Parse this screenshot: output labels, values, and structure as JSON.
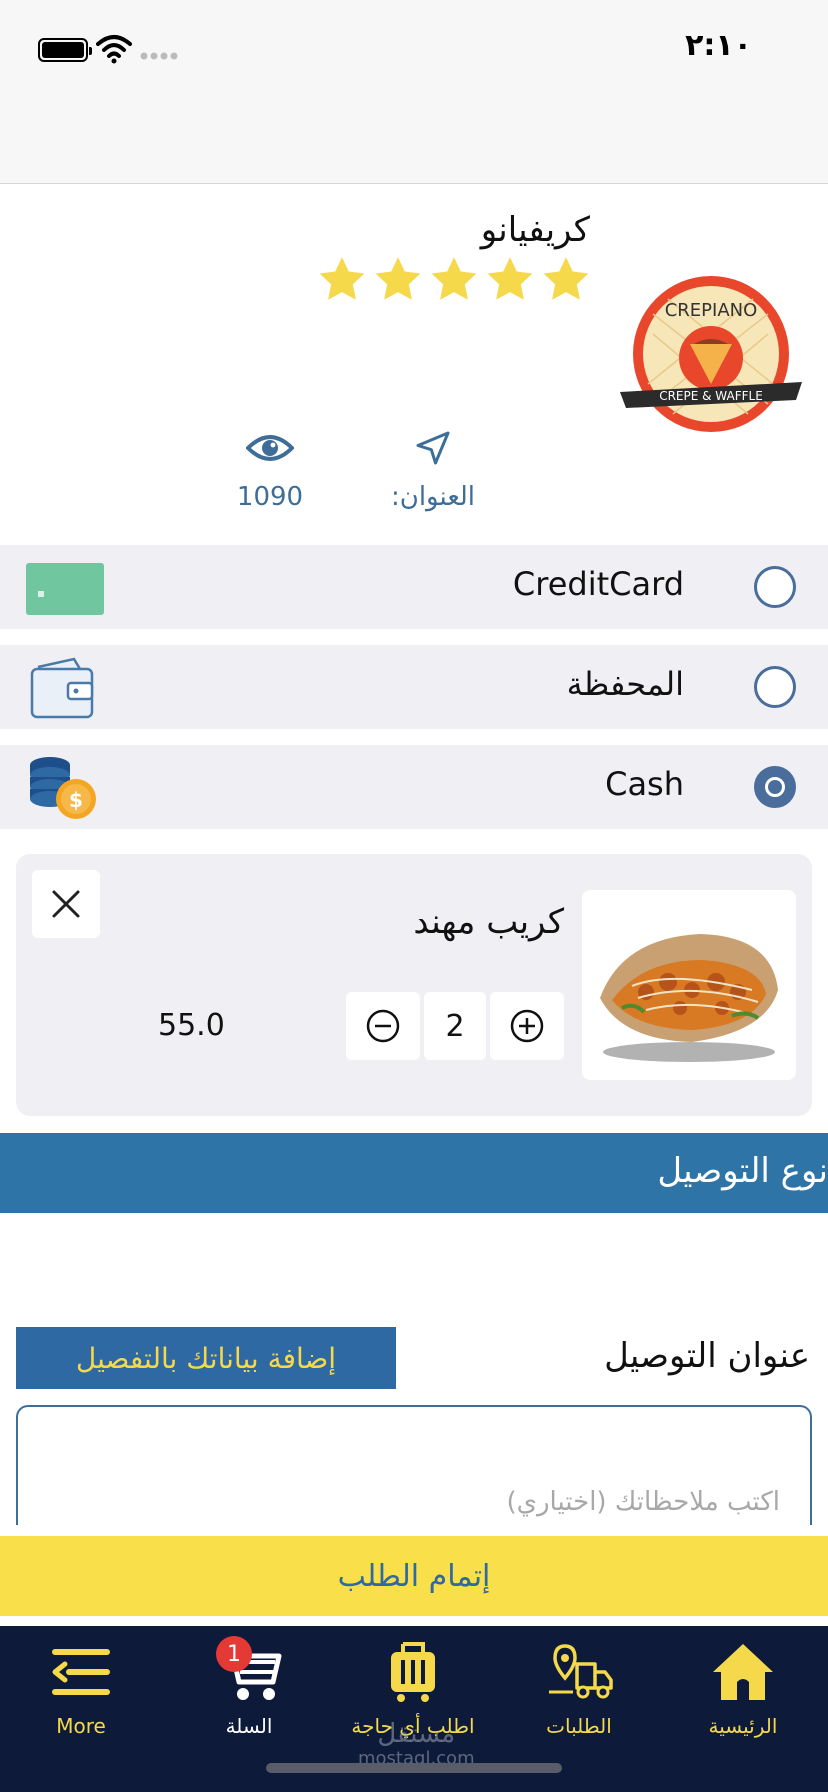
{
  "status": {
    "time": "٢:١٠"
  },
  "store": {
    "name": "كريفيانو",
    "rating": 5,
    "views": "1090",
    "address_label": "العنوان:",
    "logo": {
      "top": "CREPIANO",
      "banner": "CREPE & WAFFLE"
    }
  },
  "payment_methods": [
    {
      "label": "CreditCard",
      "icon": "credit-card-icon",
      "selected": false
    },
    {
      "label": "المحفظة",
      "icon": "wallet-icon",
      "selected": false
    },
    {
      "label": "Cash",
      "icon": "coins-icon",
      "selected": true
    }
  ],
  "cart_item": {
    "name": "كريب مهند",
    "quantity": "2",
    "price": "55.0"
  },
  "delivery": {
    "header": "نوع التوصيل",
    "address_title": "عنوان التوصيل",
    "details_button": "إضافة بياناتك بالتفصيل",
    "notes_placeholder": "اكتب ملاحظاتك (اختياري)"
  },
  "submit_label": "إتمام الطلب",
  "tabbar": {
    "items": [
      {
        "label": "More",
        "icon": "menu-icon"
      },
      {
        "label": "السلة",
        "icon": "cart-icon",
        "badge": "1"
      },
      {
        "label": "اطلب أي حاجة",
        "icon": "shopping-bag-icon"
      },
      {
        "label": "الطلبات",
        "icon": "delivery-truck-icon"
      },
      {
        "label": "الرئيسية",
        "icon": "home-icon"
      }
    ]
  },
  "watermark": {
    "ar": "مستقل",
    "en": "mostaql.com"
  },
  "colors": {
    "primary": "#2f74a6",
    "accent": "#f9df49",
    "tabbar": "#0d1a3a",
    "star": "#f5d94a"
  }
}
